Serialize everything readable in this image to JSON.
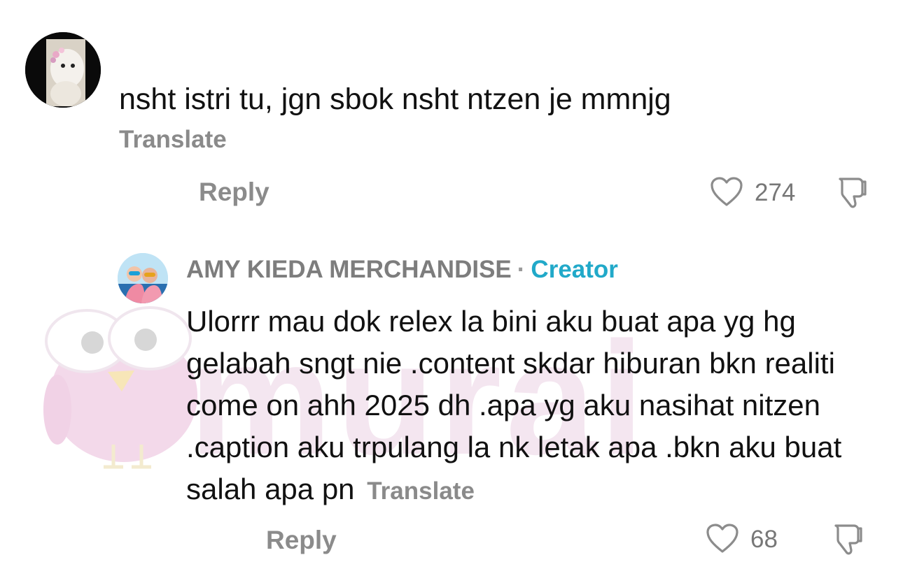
{
  "comment": {
    "text": "nsht istri tu, jgn sbok nsht ntzen je mmnjg",
    "translate_label": "Translate",
    "reply_label": "Reply",
    "likes": "274"
  },
  "reply": {
    "author": "AMY KIEDA MERCHANDISE",
    "separator": "·",
    "badge": "Creator",
    "text": "Ulorrr mau dok relex la bini aku buat apa yg hg gelabah sngt nie .content skdar hiburan bkn realiti come on ahh 2025 dh .apa yg aku nasihat nitzen .caption aku trpulang la nk letak apa .bkn aku buat salah apa pn",
    "translate_label": "Translate",
    "reply_label": "Reply",
    "likes": "68"
  },
  "watermark": {
    "text": "murai"
  },
  "icons": {
    "like": "heart-outline-icon",
    "dislike": "thumbs-down-icon"
  },
  "colors": {
    "creator_badge": "#21a9c9",
    "secondary_text": "#8b8b8b",
    "watermark": "#f4e6f0"
  }
}
